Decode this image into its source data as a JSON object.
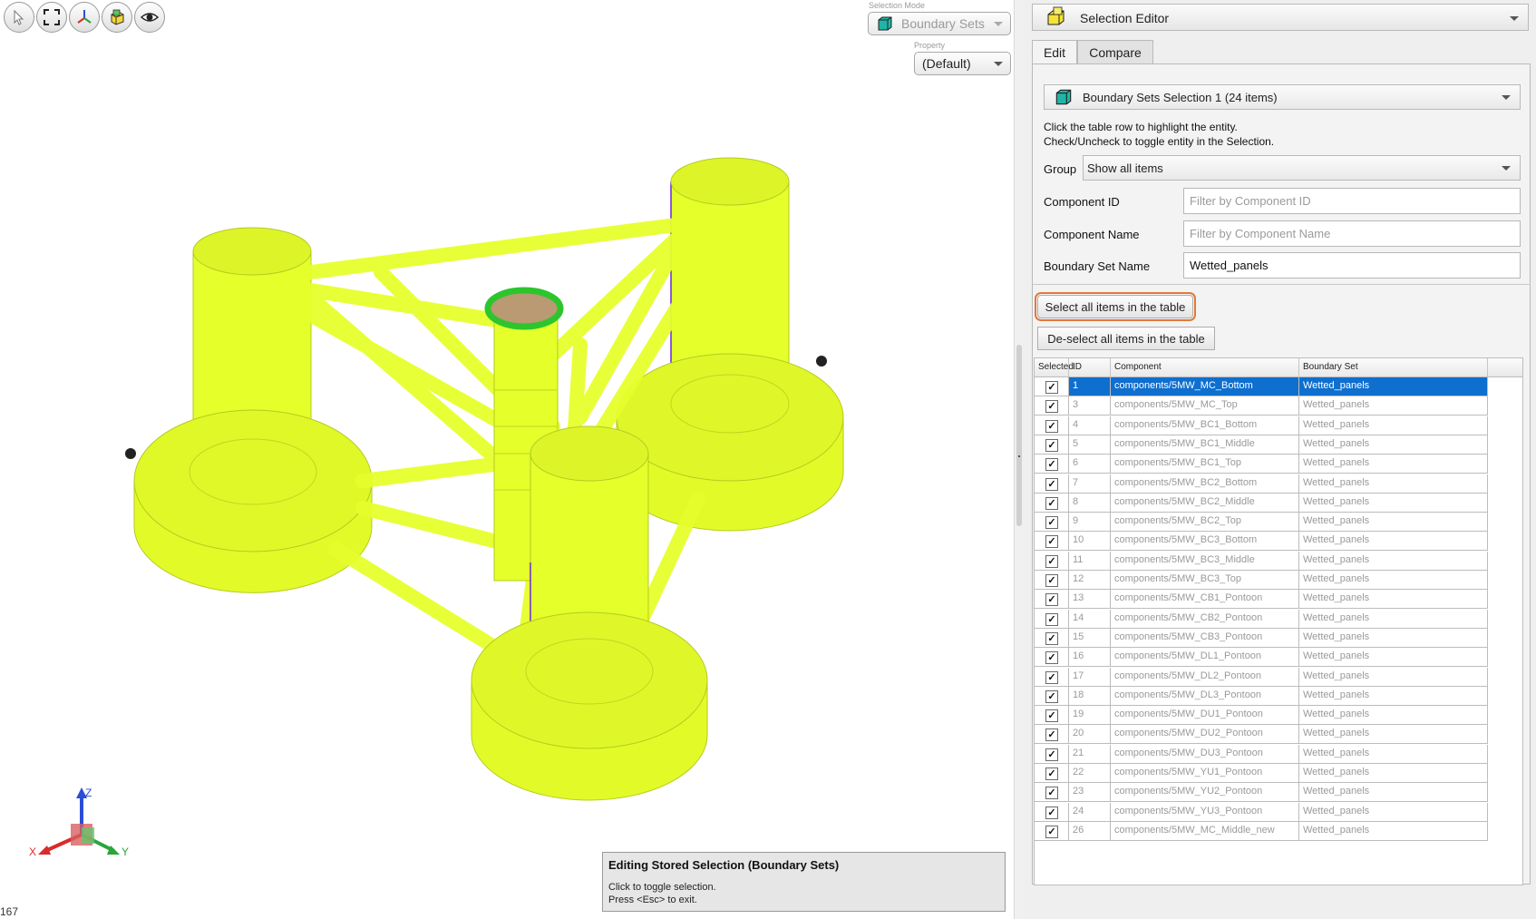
{
  "toolbar": {
    "buttons": [
      {
        "icon": "select-arrow-icon"
      },
      {
        "icon": "fit-view-icon"
      },
      {
        "icon": "axes-view-icon"
      },
      {
        "icon": "cube-view-icon"
      },
      {
        "icon": "eye-icon"
      }
    ]
  },
  "selection_mode": {
    "label": "Selection Mode",
    "value": "Boundary Sets"
  },
  "property": {
    "label": "Property",
    "value": "(Default)"
  },
  "axes": {
    "x": "X",
    "y": "Y",
    "z": "Z"
  },
  "hint": {
    "title": "Editing Stored Selection (Boundary Sets)",
    "line1": "Click to toggle selection.",
    "line2": "Press <Esc> to exit."
  },
  "counter": "167",
  "panel": {
    "title": "Selection Editor",
    "tabs": [
      {
        "label": "Edit"
      },
      {
        "label": "Compare"
      }
    ],
    "selection": "Boundary Sets Selection 1 (24 items)",
    "help1": "Click the table row to highlight the entity.",
    "help2": "Check/Uncheck to toggle entity in the Selection.",
    "group_label": "Group",
    "group_value": "Show all items",
    "component_id_label": "Component ID",
    "component_id_placeholder": "Filter by Component ID",
    "component_name_label": "Component Name",
    "component_name_placeholder": "Filter by Component Name",
    "boundary_set_label": "Boundary Set Name",
    "boundary_set_value": "Wetted_panels",
    "select_all": "Select all items in the table",
    "deselect_all": "De-select all items in the table"
  },
  "table": {
    "columns": [
      "Selected",
      "ID",
      "Component",
      "Boundary Set"
    ],
    "rows": [
      {
        "id": "1",
        "component": "components/5MW_MC_Bottom",
        "set": "Wetted_panels",
        "checked": true,
        "selected": true
      },
      {
        "id": "3",
        "component": "components/5MW_MC_Top",
        "set": "Wetted_panels",
        "checked": true
      },
      {
        "id": "4",
        "component": "components/5MW_BC1_Bottom",
        "set": "Wetted_panels",
        "checked": true
      },
      {
        "id": "5",
        "component": "components/5MW_BC1_Middle",
        "set": "Wetted_panels",
        "checked": true
      },
      {
        "id": "6",
        "component": "components/5MW_BC1_Top",
        "set": "Wetted_panels",
        "checked": true
      },
      {
        "id": "7",
        "component": "components/5MW_BC2_Bottom",
        "set": "Wetted_panels",
        "checked": true
      },
      {
        "id": "8",
        "component": "components/5MW_BC2_Middle",
        "set": "Wetted_panels",
        "checked": true
      },
      {
        "id": "9",
        "component": "components/5MW_BC2_Top",
        "set": "Wetted_panels",
        "checked": true
      },
      {
        "id": "10",
        "component": "components/5MW_BC3_Bottom",
        "set": "Wetted_panels",
        "checked": true
      },
      {
        "id": "11",
        "component": "components/5MW_BC3_Middle",
        "set": "Wetted_panels",
        "checked": true
      },
      {
        "id": "12",
        "component": "components/5MW_BC3_Top",
        "set": "Wetted_panels",
        "checked": true
      },
      {
        "id": "13",
        "component": "components/5MW_CB1_Pontoon",
        "set": "Wetted_panels",
        "checked": true
      },
      {
        "id": "14",
        "component": "components/5MW_CB2_Pontoon",
        "set": "Wetted_panels",
        "checked": true
      },
      {
        "id": "15",
        "component": "components/5MW_CB3_Pontoon",
        "set": "Wetted_panels",
        "checked": true
      },
      {
        "id": "16",
        "component": "components/5MW_DL1_Pontoon",
        "set": "Wetted_panels",
        "checked": true
      },
      {
        "id": "17",
        "component": "components/5MW_DL2_Pontoon",
        "set": "Wetted_panels",
        "checked": true
      },
      {
        "id": "18",
        "component": "components/5MW_DL3_Pontoon",
        "set": "Wetted_panels",
        "checked": true
      },
      {
        "id": "19",
        "component": "components/5MW_DU1_Pontoon",
        "set": "Wetted_panels",
        "checked": true
      },
      {
        "id": "20",
        "component": "components/5MW_DU2_Pontoon",
        "set": "Wetted_panels",
        "checked": true
      },
      {
        "id": "21",
        "component": "components/5MW_DU3_Pontoon",
        "set": "Wetted_panels",
        "checked": true
      },
      {
        "id": "22",
        "component": "components/5MW_YU1_Pontoon",
        "set": "Wetted_panels",
        "checked": true
      },
      {
        "id": "23",
        "component": "components/5MW_YU2_Pontoon",
        "set": "Wetted_panels",
        "checked": true
      },
      {
        "id": "24",
        "component": "components/5MW_YU3_Pontoon",
        "set": "Wetted_panels",
        "checked": true
      },
      {
        "id": "26",
        "component": "components/5MW_MC_Middle_new",
        "set": "Wetted_panels",
        "checked": true
      }
    ]
  },
  "colors": {
    "mesh": "#e4ff2a",
    "mesh_edge": "#b7cc22",
    "highlight": "#2dc52d",
    "selected_row": "#0e6fcf",
    "focus_outline": "#e07a3a"
  }
}
